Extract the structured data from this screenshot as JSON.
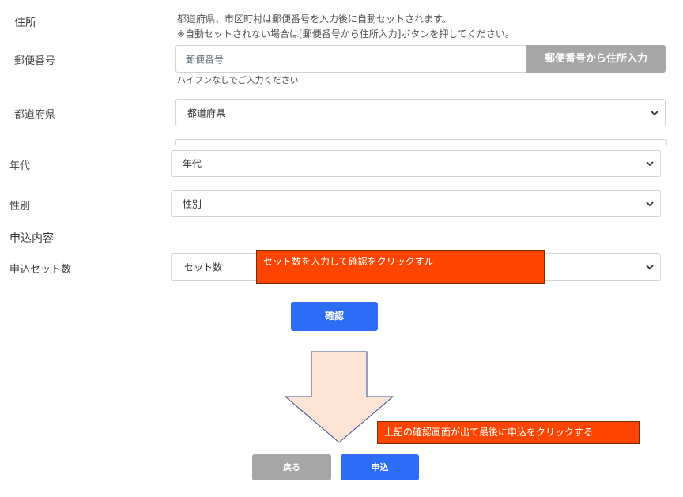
{
  "address": {
    "label": "住所",
    "note_line1": "都道府県、市区町村は郵便番号を入力後に自動セットされます。",
    "note_line2": "※自動セットされない場合は[郵便番号から住所入力]ボタンを押してください。"
  },
  "postal": {
    "label": "郵便番号",
    "placeholder": "郵便番号",
    "lookup_button": "郵便番号から住所入力",
    "hint": "ハイフンなしでご入力ください"
  },
  "prefecture": {
    "label": "都道府県",
    "selected": "都道府県"
  },
  "age": {
    "label": "年代",
    "selected": "年代"
  },
  "gender": {
    "label": "性別",
    "selected": "性別"
  },
  "application": {
    "section_title": "申込内容",
    "set_count_label": "申込セット数",
    "set_count_selected": "セット数"
  },
  "buttons": {
    "confirm": "確認",
    "back": "戻る",
    "apply": "申込"
  },
  "annotations": {
    "enter_and_confirm": "セット数を入力して確認をクリックすル",
    "apply_instruction": "上記の確認画面が出て最後に申込をクリックする"
  },
  "colors": {
    "primary_button": "#2d6df6",
    "secondary_button": "#a6a6a6",
    "annotation_fill": "#ff4500",
    "arrow_fill": "#fce4d6"
  }
}
